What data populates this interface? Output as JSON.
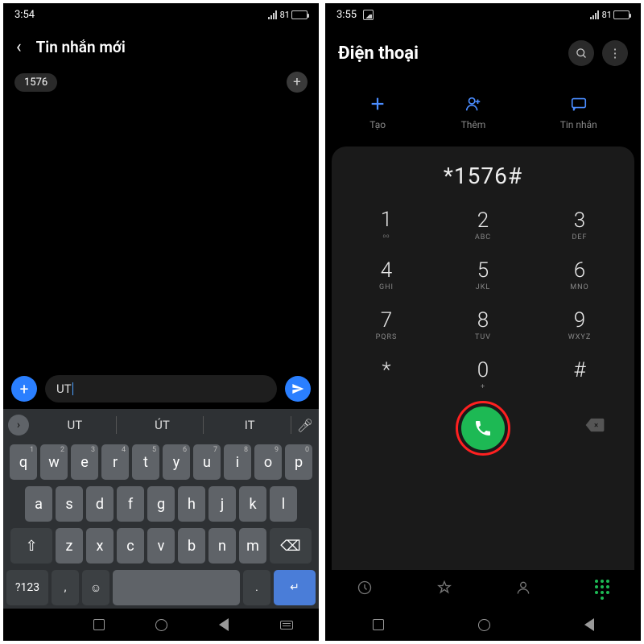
{
  "left": {
    "status_time": "3:54",
    "battery": "81",
    "title": "Tin nhắn mới",
    "recipient_chip": "1576",
    "compose_value": "UT",
    "suggestions": [
      "UT",
      "ÚT",
      "IT"
    ],
    "keyboard": {
      "row1": [
        "q",
        "w",
        "e",
        "r",
        "t",
        "y",
        "u",
        "i",
        "o",
        "p"
      ],
      "row1_sup": [
        "1",
        "2",
        "3",
        "4",
        "5",
        "6",
        "7",
        "8",
        "9",
        "0"
      ],
      "row2": [
        "a",
        "s",
        "d",
        "f",
        "g",
        "h",
        "j",
        "k",
        "l"
      ],
      "row3": [
        "z",
        "x",
        "c",
        "v",
        "b",
        "n",
        "m"
      ],
      "sym_key": "?123",
      "comma": ",",
      "period": "."
    }
  },
  "right": {
    "status_time": "3:55",
    "battery": "81",
    "title": "Điện thoại",
    "quick": {
      "create": "Tạo",
      "add": "Thêm",
      "msg": "Tin nhắn"
    },
    "dialed": "*1576#",
    "keys": [
      {
        "n": "1",
        "s": "ᵒᵒ"
      },
      {
        "n": "2",
        "s": "ABC"
      },
      {
        "n": "3",
        "s": "DEF"
      },
      {
        "n": "4",
        "s": "GHI"
      },
      {
        "n": "5",
        "s": "JKL"
      },
      {
        "n": "6",
        "s": "MNO"
      },
      {
        "n": "7",
        "s": "PQRS"
      },
      {
        "n": "8",
        "s": "TUV"
      },
      {
        "n": "9",
        "s": "WXYZ"
      },
      {
        "n": "*",
        "s": ""
      },
      {
        "n": "0",
        "s": "+"
      },
      {
        "n": "#",
        "s": ""
      }
    ]
  }
}
